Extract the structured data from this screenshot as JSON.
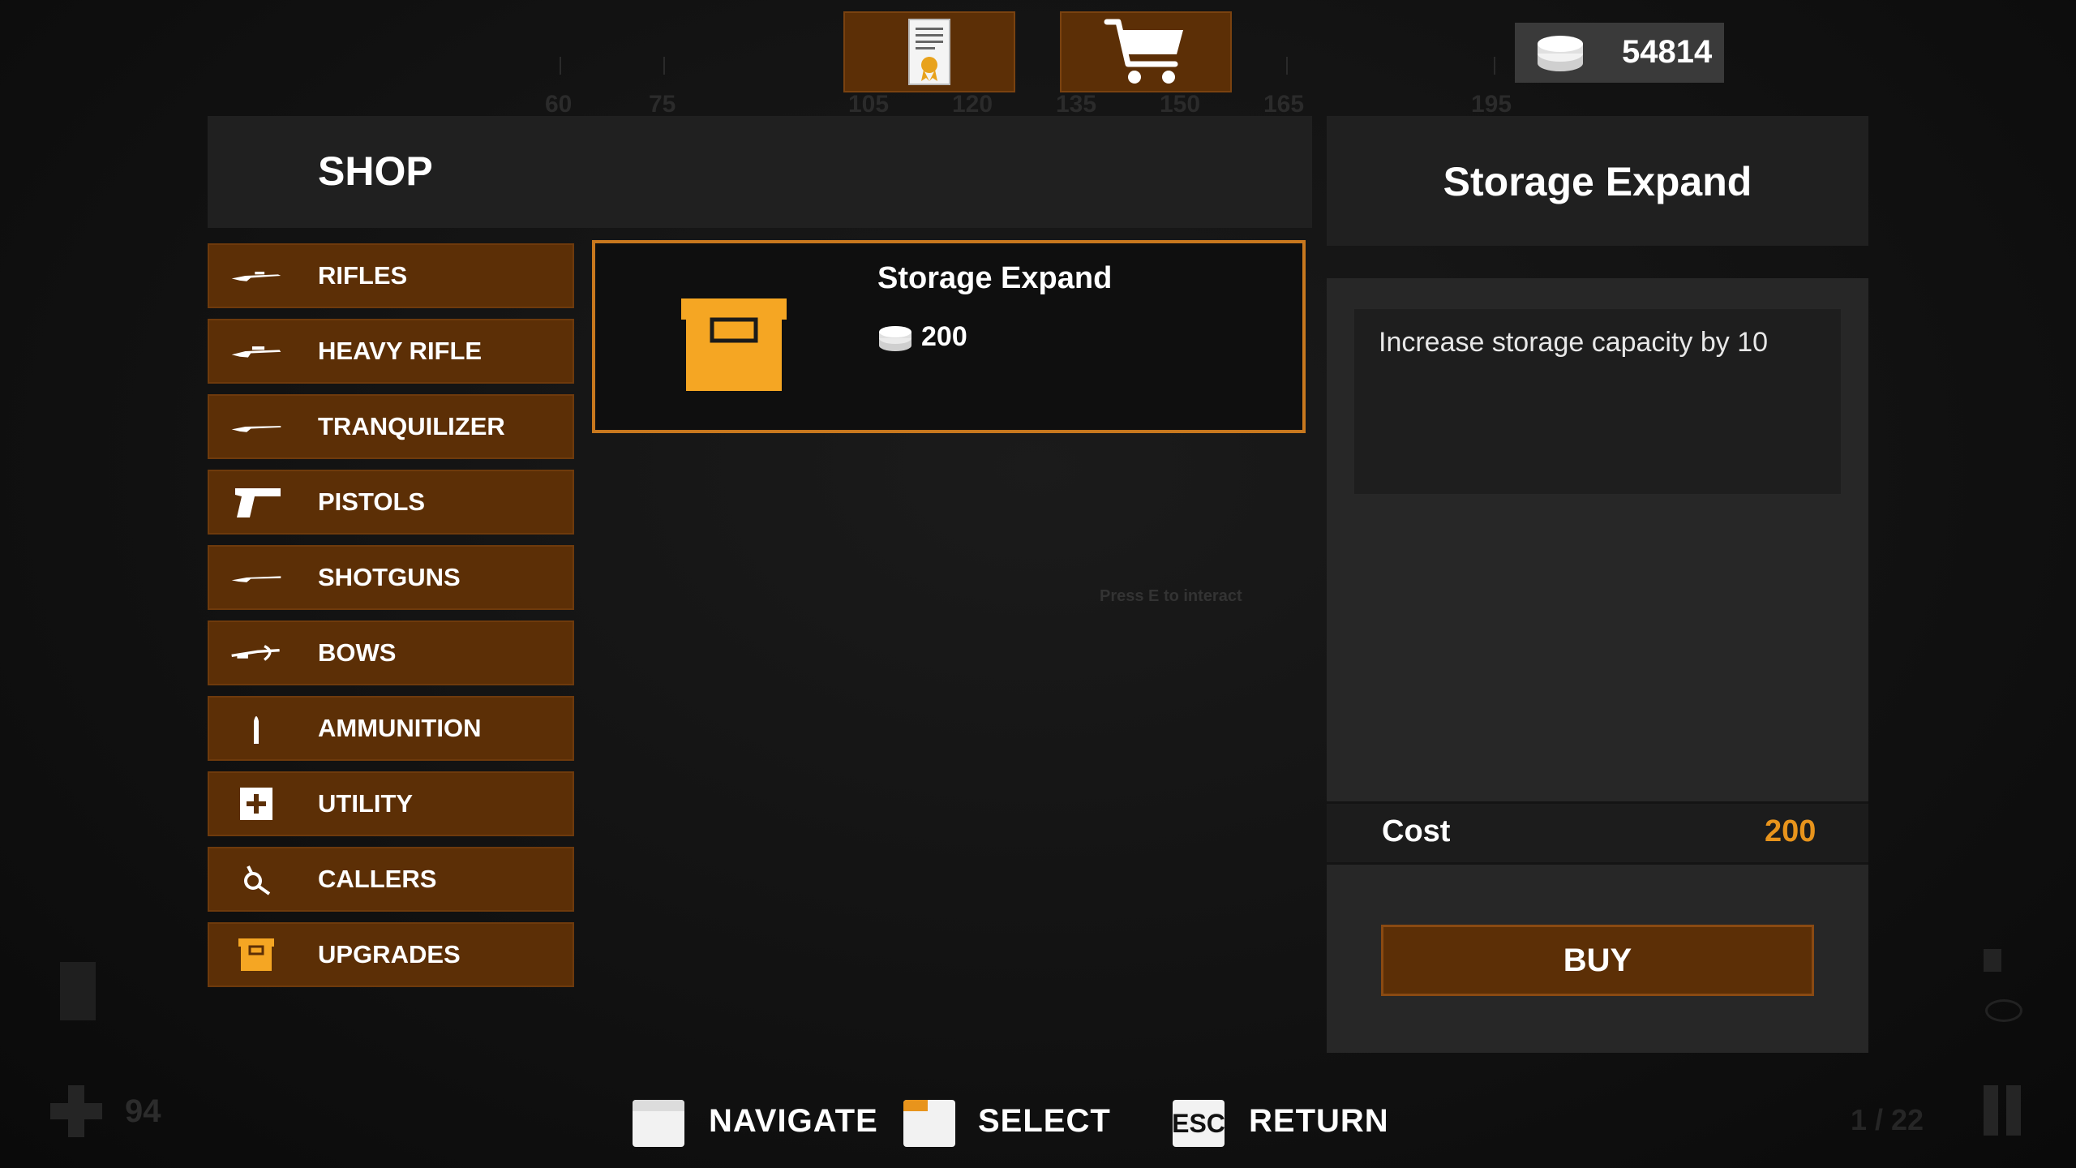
{
  "background_hud": {
    "compass_numbers": [
      "60",
      "75",
      "105",
      "120",
      "135",
      "150",
      "165",
      "195"
    ],
    "interact_hint": "Press E to interact",
    "health_value": "94",
    "page_counter": "1 / 22"
  },
  "top_bar": {
    "icons": [
      "certificate-icon",
      "cart-icon",
      "coins-icon"
    ],
    "money": "54814"
  },
  "shop": {
    "title": "SHOP",
    "categories": [
      {
        "label": "RIFLES",
        "icon": "rifle-icon"
      },
      {
        "label": "HEAVY RIFLE",
        "icon": "heavy-rifle-icon"
      },
      {
        "label": "TRANQUILIZER",
        "icon": "tranquilizer-icon"
      },
      {
        "label": "PISTOLS",
        "icon": "pistol-icon"
      },
      {
        "label": "SHOTGUNS",
        "icon": "shotgun-icon"
      },
      {
        "label": "BOWS",
        "icon": "bow-icon"
      },
      {
        "label": "AMMUNITION",
        "icon": "bullet-icon"
      },
      {
        "label": "UTILITY",
        "icon": "medkit-icon"
      },
      {
        "label": "CALLERS",
        "icon": "caller-icon"
      },
      {
        "label": "UPGRADES",
        "icon": "crate-icon"
      }
    ],
    "selected_item": {
      "name": "Storage Expand",
      "price": "200",
      "icon": "crate-icon"
    }
  },
  "details": {
    "title": "Storage Expand",
    "description": "Increase storage capacity by 10",
    "cost_label": "Cost",
    "cost_value": "200",
    "buy_label": "BUY"
  },
  "hints": {
    "navigate": "NAVIGATE",
    "select": "SELECT",
    "esc_key": "ESC",
    "return": "RETURN"
  },
  "colors": {
    "button_brown": "#5c2f06",
    "accent_orange": "#e8941c",
    "crate_orange": "#f5a623"
  }
}
